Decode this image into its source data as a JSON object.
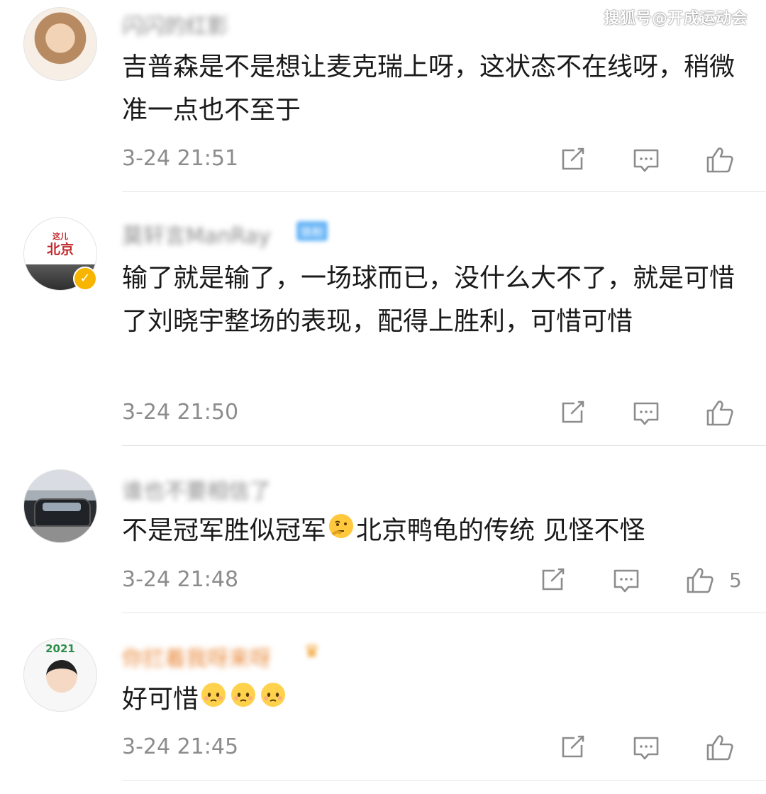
{
  "watermark": "搜狐号@开成运动会",
  "comments": [
    {
      "username": "闪闪的红影",
      "text": "吉普森是不是想让麦克瑞上呀，这状态不在线呀，稍微准一点也不至于",
      "time": "3-24 21:51",
      "likes": ""
    },
    {
      "username": "莫轩言ManRay",
      "avatar_text_top": "这儿",
      "avatar_text_main": "北京",
      "verified": true,
      "text": "输了就是输了，一场球而已，没什么大不了，就是可惜了刘晓宇整场的表现，配得上胜利，可惜可惜",
      "time": "3-24 21:50",
      "likes": ""
    },
    {
      "username": "谁也不要相信了",
      "text_before_emoji": "不是冠军胜似冠军",
      "emoji_1": "thinking-emoji",
      "text_after_emoji": "北京鸭龟的传统 见怪不怪",
      "time": "3-24 21:48",
      "likes": "5"
    },
    {
      "username": "你拦着我呀来呀",
      "avatar_text": "2021",
      "text": "好可惜",
      "emojis": [
        "sad-emoji",
        "sad-emoji",
        "sad-emoji"
      ],
      "time": "3-24 21:45",
      "likes": ""
    }
  ],
  "icons": {
    "share": "share-icon",
    "reply": "comment-icon",
    "like": "thumbs-up-icon"
  },
  "colors": {
    "text": "#1a1a1a",
    "meta": "#8c8c8c",
    "divider": "#e5e5e5",
    "verified_badge": "#f7b500",
    "vip_name": "#e8883a"
  }
}
